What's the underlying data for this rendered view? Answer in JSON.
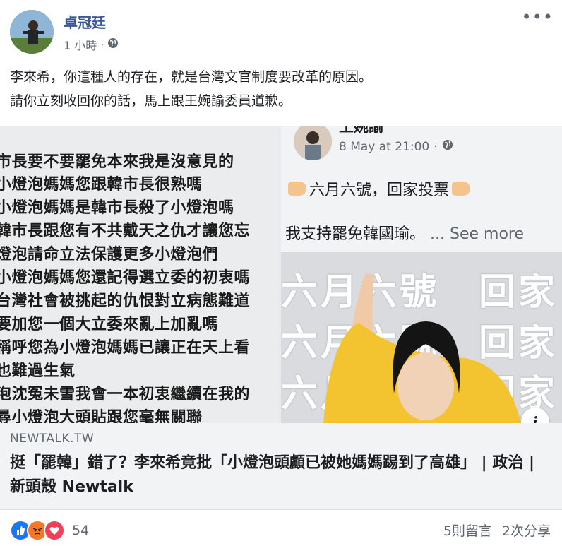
{
  "post": {
    "author": "卓冠廷",
    "time": "1 小時",
    "more_label": "•••",
    "lines": [
      "李來希，你這種人的存在，就是台灣文官制度要改革的原因。",
      "請你立刻收回你的話，馬上跟王婉諭委員道歉。"
    ]
  },
  "preview": {
    "left_lines": [
      "市長要不要罷免本來我是沒意見的",
      "小燈泡媽媽您跟韓市長很熟嗎",
      "小燈泡媽媽是韓市長殺了小燈泡嗎",
      "韓市長跟您有不共戴天之仇才讓您忘",
      "燈泡請命立法保護更多小燈泡們",
      "小燈泡媽媽您還記得選立委的初衷嗎",
      "台灣社會被挑起的仇恨對立病態難道",
      "要加您一個大立委來亂上加亂嗎",
      "稱呼您為小燈泡媽媽已讓正在天上看",
      "也難過生氣",
      "泡沈冤未雪我會一本初衷繼續在我的",
      "尋小燈泡大頭貼跟您毫無關聯"
    ],
    "right": {
      "name": "王婉諭",
      "time": "8 May at 21:00",
      "line1": "六月六號，回家投票",
      "line2": "我支持罷免韓國瑜。",
      "see_more": "... See more",
      "photo_text_top": "六月六號　回家",
      "photo_text_mid": "六月六號　回家",
      "photo_text_bot": "六月六號　回家"
    }
  },
  "link": {
    "domain": "NEWTALK.TW",
    "headline": "挺「罷韓」錯了？李來希竟批「小燈泡頭顱已被她媽媽踢到了高雄」 | 政治 | 新頭殼 Newtalk",
    "info_label": "i"
  },
  "footer": {
    "reaction_count": "54",
    "comments": "5則留言",
    "shares": "2次分享"
  },
  "colors": {
    "author_link": "#365899",
    "like": "#1877f2",
    "angry": "#f0792c",
    "love": "#f33e58"
  }
}
